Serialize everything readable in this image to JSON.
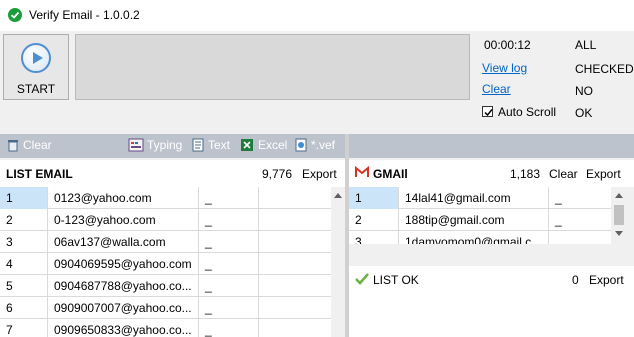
{
  "window": {
    "title": "Verify Email - 1.0.0.2"
  },
  "controls": {
    "start_label": "START",
    "timer": "00:00:12",
    "view_log": "View log",
    "clear": "Clear",
    "auto_scroll": "Auto Scroll",
    "auto_scroll_checked": true
  },
  "status": [
    "ALL",
    "CHECKED",
    "NO",
    "OK"
  ],
  "toolbar": {
    "clear": "Clear",
    "typing": "Typing",
    "text": "Text",
    "excel": "Excel",
    "vef": "*.vef"
  },
  "list_email": {
    "title": "LIST EMAIL",
    "count": "9,776",
    "export": "Export",
    "rows": [
      {
        "n": "1",
        "email": "0123@yahoo.com",
        "status": "_"
      },
      {
        "n": "2",
        "email": "0-123@yahoo.com",
        "status": "_"
      },
      {
        "n": "3",
        "email": "06av137@walla.com",
        "status": "_"
      },
      {
        "n": "4",
        "email": "0904069595@yahoo.com",
        "status": "_"
      },
      {
        "n": "5",
        "email": "0904687788@yahoo.co...",
        "status": "_"
      },
      {
        "n": "6",
        "email": "0909007007@yahoo.co...",
        "status": "_"
      },
      {
        "n": "7",
        "email": "0909650833@yahoo.co...",
        "status": "_"
      }
    ]
  },
  "gmail": {
    "title": "GMAIl",
    "count": "1,183",
    "clear": "Clear",
    "export": "Export",
    "rows": [
      {
        "n": "1",
        "email": "14lal41@gmail.com",
        "status": "_"
      },
      {
        "n": "2",
        "email": "188tip@gmail.com",
        "status": "_"
      },
      {
        "n": "3",
        "email": "1damvomom0@gmail.c",
        "status": ""
      }
    ]
  },
  "list_ok": {
    "title": "LIST OK",
    "count": "0",
    "export": "Export"
  },
  "colors": {
    "toolbar_bg": "#bcc3cc",
    "selected_row": "#cce4f7",
    "link": "#0066cc",
    "title_icon": "#1c9d3c"
  }
}
